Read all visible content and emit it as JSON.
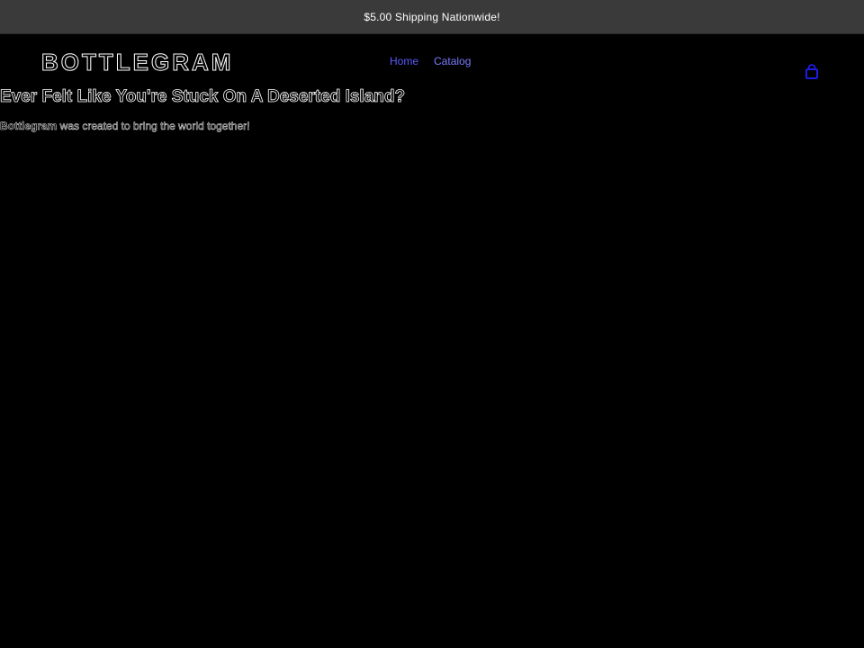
{
  "announcement": {
    "text": "$5.00 Shipping Nationwide!"
  },
  "header": {
    "logo": "BOTTLEGRAM",
    "nav": [
      {
        "label": "Home"
      },
      {
        "label": "Catalog"
      }
    ],
    "cart_icon": "bag-icon",
    "link_color": "#7b7bff",
    "icon_color": "#1f1fff"
  },
  "hero": {
    "heading": "Ever Felt Like You're Stuck On A Deserted Island?",
    "body_brand": "Bottlegram",
    "body_rest": " was created to bring the world together!"
  }
}
